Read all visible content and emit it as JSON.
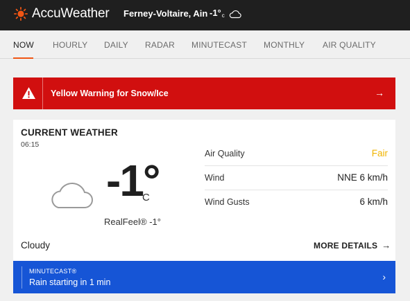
{
  "header": {
    "brand": "AccuWeather",
    "location": "Ferney-Voltaire, Ain",
    "temp": "-1°",
    "temp_unit": "c",
    "weather_icon": "cloud-icon"
  },
  "tabs": [
    {
      "label": "NOW",
      "active": true
    },
    {
      "label": "HOURLY"
    },
    {
      "label": "DAILY"
    },
    {
      "label": "RADAR"
    },
    {
      "label": "MINUTECAST"
    },
    {
      "label": "MONTHLY"
    },
    {
      "label": "AIR QUALITY"
    }
  ],
  "alert": {
    "icon": "warning-icon",
    "text": "Yellow Warning for Snow/Ice",
    "arrow": "→"
  },
  "current": {
    "title": "CURRENT WEATHER",
    "time": "06:15",
    "temp": "-1°",
    "unit": "C",
    "realfeel": "RealFeel® -1°",
    "condition": "Cloudy",
    "more_details": "MORE DETAILS",
    "more_arrow": "→",
    "stats": [
      {
        "label": "Air Quality",
        "value": "Fair"
      },
      {
        "label": "Wind",
        "value": "NNE 6 km/h"
      },
      {
        "label": "Wind Gusts",
        "value": "6 km/h"
      }
    ]
  },
  "minutecast": {
    "label": "MINUTECAST®",
    "text": "Rain starting in 1 min",
    "arrow": "›"
  },
  "colors": {
    "brand_orange": "#f05514",
    "alert_red": "#d10f0f",
    "minutecast_blue": "#1655d6",
    "fair_yellow": "#f0b400",
    "topbar": "#1f1f1f"
  }
}
